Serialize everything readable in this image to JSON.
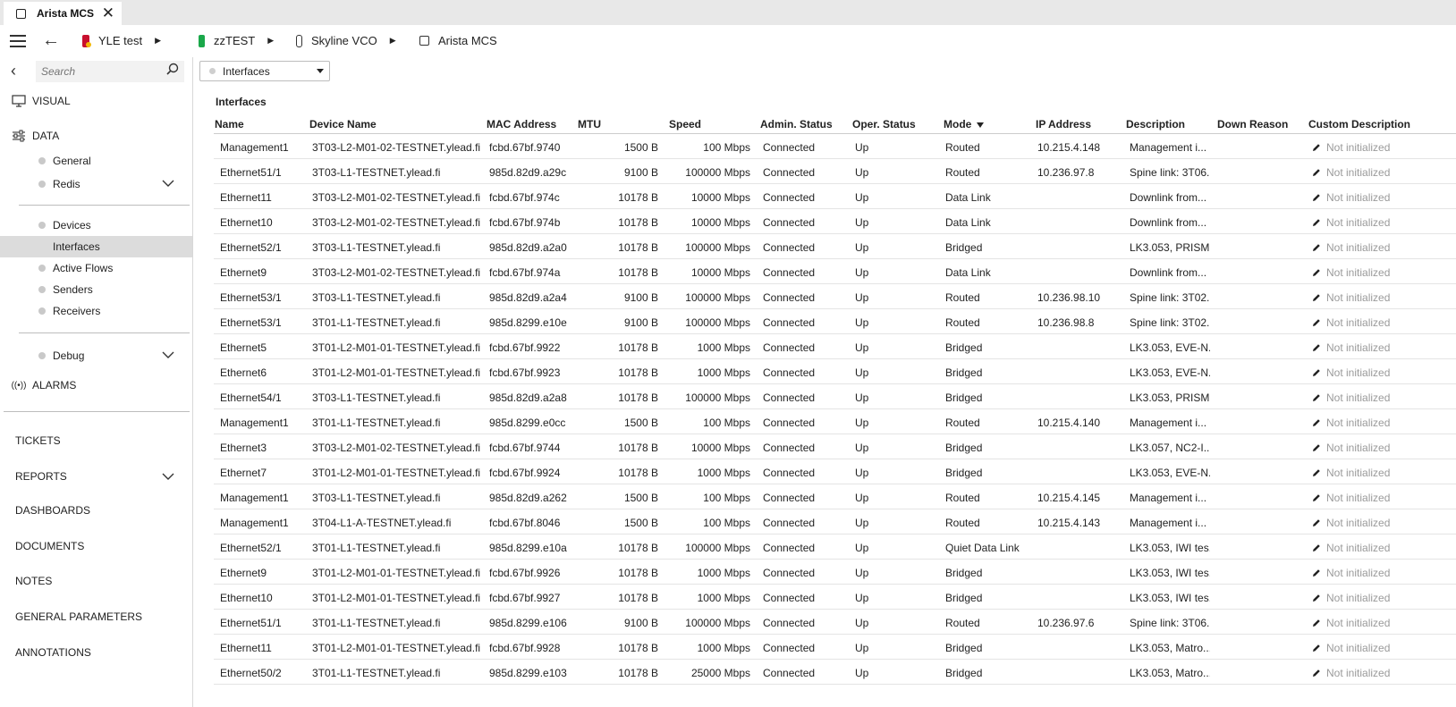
{
  "tab": {
    "title": "Arista MCS"
  },
  "breadcrumb": [
    {
      "label": "YLE test"
    },
    {
      "label": "zzTEST"
    },
    {
      "label": "Skyline VCO"
    },
    {
      "label": "Arista MCS"
    }
  ],
  "sidebar": {
    "search_placeholder": "Search",
    "visual_label": "VISUAL",
    "data_label": "DATA",
    "group1": [
      "General",
      "Redis"
    ],
    "group2": [
      "Devices",
      "Interfaces",
      "Active Flows",
      "Senders",
      "Receivers"
    ],
    "active_item": "Interfaces",
    "debug_label": "Debug",
    "alarms_label": "ALARMS",
    "links": [
      "TICKETS",
      "REPORTS",
      "DASHBOARDS",
      "DOCUMENTS",
      "NOTES",
      "GENERAL PARAMETERS",
      "ANNOTATIONS"
    ]
  },
  "main": {
    "dropdown_value": "Interfaces",
    "title": "Interfaces",
    "columns": [
      "Name",
      "Device Name",
      "MAC Address",
      "MTU",
      "Speed",
      "Admin. Status",
      "Oper. Status",
      "Mode",
      "IP Address",
      "Description",
      "Down Reason",
      "Custom Description"
    ],
    "rows": [
      [
        "Management1",
        "3T03-L2-M01-02-TESTNET.ylead.fi",
        "fcbd.67bf.9740",
        "1500 B",
        "100 Mbps",
        "Connected",
        "Up",
        "Routed",
        "10.215.4.148",
        "Management i...",
        "",
        "Not initialized"
      ],
      [
        "Ethernet51/1",
        "3T03-L1-TESTNET.ylead.fi",
        "985d.82d9.a29c",
        "9100 B",
        "100000 Mbps",
        "Connected",
        "Up",
        "Routed",
        "10.236.97.8",
        "Spine link: 3T06...",
        "",
        "Not initialized"
      ],
      [
        "Ethernet11",
        "3T03-L2-M01-02-TESTNET.ylead.fi",
        "fcbd.67bf.974c",
        "10178 B",
        "10000 Mbps",
        "Connected",
        "Up",
        "Data Link",
        "",
        "Downlink from...",
        "",
        "Not initialized"
      ],
      [
        "Ethernet10",
        "3T03-L2-M01-02-TESTNET.ylead.fi",
        "fcbd.67bf.974b",
        "10178 B",
        "10000 Mbps",
        "Connected",
        "Up",
        "Data Link",
        "",
        "Downlink from...",
        "",
        "Not initialized"
      ],
      [
        "Ethernet52/1",
        "3T03-L1-TESTNET.ylead.fi",
        "985d.82d9.a2a0",
        "10178 B",
        "100000 Mbps",
        "Connected",
        "Up",
        "Bridged",
        "",
        "LK3.053, PRISM...",
        "",
        "Not initialized"
      ],
      [
        "Ethernet9",
        "3T03-L2-M01-02-TESTNET.ylead.fi",
        "fcbd.67bf.974a",
        "10178 B",
        "10000 Mbps",
        "Connected",
        "Up",
        "Data Link",
        "",
        "Downlink from...",
        "",
        "Not initialized"
      ],
      [
        "Ethernet53/1",
        "3T03-L1-TESTNET.ylead.fi",
        "985d.82d9.a2a4",
        "9100 B",
        "100000 Mbps",
        "Connected",
        "Up",
        "Routed",
        "10.236.98.10",
        "Spine link: 3T02...",
        "",
        "Not initialized"
      ],
      [
        "Ethernet53/1",
        "3T01-L1-TESTNET.ylead.fi",
        "985d.8299.e10e",
        "9100 B",
        "100000 Mbps",
        "Connected",
        "Up",
        "Routed",
        "10.236.98.8",
        "Spine link: 3T02...",
        "",
        "Not initialized"
      ],
      [
        "Ethernet5",
        "3T01-L2-M01-01-TESTNET.ylead.fi",
        "fcbd.67bf.9922",
        "10178 B",
        "1000 Mbps",
        "Connected",
        "Up",
        "Bridged",
        "",
        "LK3.053, EVE-N...",
        "",
        "Not initialized"
      ],
      [
        "Ethernet6",
        "3T01-L2-M01-01-TESTNET.ylead.fi",
        "fcbd.67bf.9923",
        "10178 B",
        "1000 Mbps",
        "Connected",
        "Up",
        "Bridged",
        "",
        "LK3.053, EVE-N...",
        "",
        "Not initialized"
      ],
      [
        "Ethernet54/1",
        "3T03-L1-TESTNET.ylead.fi",
        "985d.82d9.a2a8",
        "10178 B",
        "100000 Mbps",
        "Connected",
        "Up",
        "Bridged",
        "",
        "LK3.053, PRISM...",
        "",
        "Not initialized"
      ],
      [
        "Management1",
        "3T01-L1-TESTNET.ylead.fi",
        "985d.8299.e0cc",
        "1500 B",
        "100 Mbps",
        "Connected",
        "Up",
        "Routed",
        "10.215.4.140",
        "Management i...",
        "",
        "Not initialized"
      ],
      [
        "Ethernet3",
        "3T03-L2-M01-02-TESTNET.ylead.fi",
        "fcbd.67bf.9744",
        "10178 B",
        "10000 Mbps",
        "Connected",
        "Up",
        "Bridged",
        "",
        "LK3.057, NC2-I...",
        "",
        "Not initialized"
      ],
      [
        "Ethernet7",
        "3T01-L2-M01-01-TESTNET.ylead.fi",
        "fcbd.67bf.9924",
        "10178 B",
        "1000 Mbps",
        "Connected",
        "Up",
        "Bridged",
        "",
        "LK3.053, EVE-N...",
        "",
        "Not initialized"
      ],
      [
        "Management1",
        "3T03-L1-TESTNET.ylead.fi",
        "985d.82d9.a262",
        "1500 B",
        "100 Mbps",
        "Connected",
        "Up",
        "Routed",
        "10.215.4.145",
        "Management i...",
        "",
        "Not initialized"
      ],
      [
        "Management1",
        "3T04-L1-A-TESTNET.ylead.fi",
        "fcbd.67bf.8046",
        "1500 B",
        "100 Mbps",
        "Connected",
        "Up",
        "Routed",
        "10.215.4.143",
        "Management i...",
        "",
        "Not initialized"
      ],
      [
        "Ethernet52/1",
        "3T01-L1-TESTNET.ylead.fi",
        "985d.8299.e10a",
        "10178 B",
        "100000 Mbps",
        "Connected",
        "Up",
        "Quiet Data Link",
        "",
        "LK3.053, IWI tes...",
        "",
        "Not initialized"
      ],
      [
        "Ethernet9",
        "3T01-L2-M01-01-TESTNET.ylead.fi",
        "fcbd.67bf.9926",
        "10178 B",
        "1000 Mbps",
        "Connected",
        "Up",
        "Bridged",
        "",
        "LK3.053, IWI tes...",
        "",
        "Not initialized"
      ],
      [
        "Ethernet10",
        "3T01-L2-M01-01-TESTNET.ylead.fi",
        "fcbd.67bf.9927",
        "10178 B",
        "1000 Mbps",
        "Connected",
        "Up",
        "Bridged",
        "",
        "LK3.053, IWI tes...",
        "",
        "Not initialized"
      ],
      [
        "Ethernet51/1",
        "3T01-L1-TESTNET.ylead.fi",
        "985d.8299.e106",
        "9100 B",
        "100000 Mbps",
        "Connected",
        "Up",
        "Routed",
        "10.236.97.6",
        "Spine link: 3T06...",
        "",
        "Not initialized"
      ],
      [
        "Ethernet11",
        "3T01-L2-M01-01-TESTNET.ylead.fi",
        "fcbd.67bf.9928",
        "10178 B",
        "1000 Mbps",
        "Connected",
        "Up",
        "Bridged",
        "",
        "LK3.053, Matro...",
        "",
        "Not initialized"
      ],
      [
        "Ethernet50/2",
        "3T01-L1-TESTNET.ylead.fi",
        "985d.8299.e103",
        "10178 B",
        "25000 Mbps",
        "Connected",
        "Up",
        "Bridged",
        "",
        "LK3.053, Matro...",
        "",
        "Not initialized"
      ]
    ]
  }
}
